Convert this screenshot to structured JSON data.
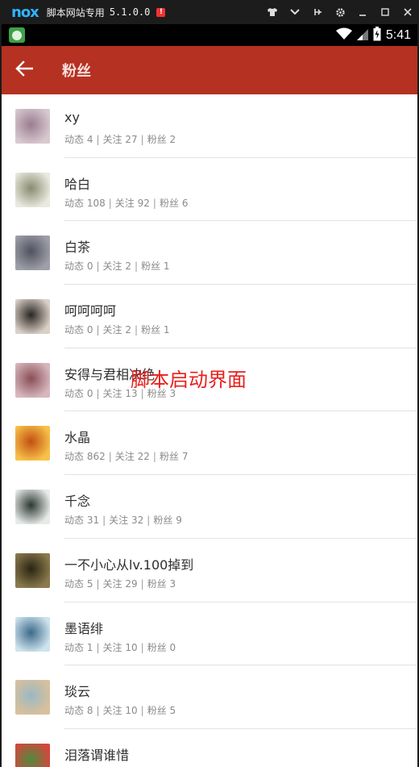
{
  "emulator": {
    "logo": "nox",
    "title": "脚本网站专用",
    "version": "5.1.0.0",
    "alert": "!"
  },
  "status_bar": {
    "time": "5:41"
  },
  "app_bar": {
    "title": "粉丝"
  },
  "overlay_text": "脚本启动界面",
  "stat_labels": {
    "posts": "动态",
    "following": "关注",
    "fans": "粉丝"
  },
  "fans": [
    {
      "name": "xy",
      "posts": 4,
      "following": 27,
      "fans": 2,
      "avatar_colors": [
        "#d8c8cf",
        "#9a7d8f"
      ]
    },
    {
      "name": "哈白",
      "posts": 108,
      "following": 92,
      "fans": 6,
      "avatar_colors": [
        "#e9eadf",
        "#8a8b70"
      ]
    },
    {
      "name": "白茶",
      "posts": 0,
      "following": 2,
      "fans": 1,
      "avatar_colors": [
        "#9e9fa8",
        "#4f525f"
      ]
    },
    {
      "name": "呵呵呵呵",
      "posts": 0,
      "following": 2,
      "fans": 1,
      "avatar_colors": [
        "#d9d0c6",
        "#2a2522"
      ]
    },
    {
      "name": "安得与君相决绝",
      "posts": 0,
      "following": 13,
      "fans": 3,
      "avatar_colors": [
        "#d7b7bd",
        "#8a4e57"
      ]
    },
    {
      "name": "水晶",
      "posts": 862,
      "following": 22,
      "fans": 7,
      "avatar_colors": [
        "#f7c24a",
        "#c24f10"
      ]
    },
    {
      "name": "千念",
      "posts": 31,
      "following": 32,
      "fans": 9,
      "avatar_colors": [
        "#e6ebe8",
        "#2d3833"
      ]
    },
    {
      "name": "一不小心从lv.100掉到",
      "posts": 5,
      "following": 29,
      "fans": 3,
      "avatar_colors": [
        "#8a7a4c",
        "#2a2412"
      ]
    },
    {
      "name": "墨语绯",
      "posts": 1,
      "following": 10,
      "fans": 0,
      "avatar_colors": [
        "#cfe3ee",
        "#3c6a8a"
      ]
    },
    {
      "name": "琰云",
      "posts": 8,
      "following": 10,
      "fans": 5,
      "avatar_colors": [
        "#d9c09c",
        "#9bb8c4"
      ]
    },
    {
      "name": "泪落谓谁惜",
      "posts": null,
      "following": null,
      "fans": null,
      "avatar_colors": [
        "#d8443e",
        "#4f8a3a"
      ]
    }
  ]
}
